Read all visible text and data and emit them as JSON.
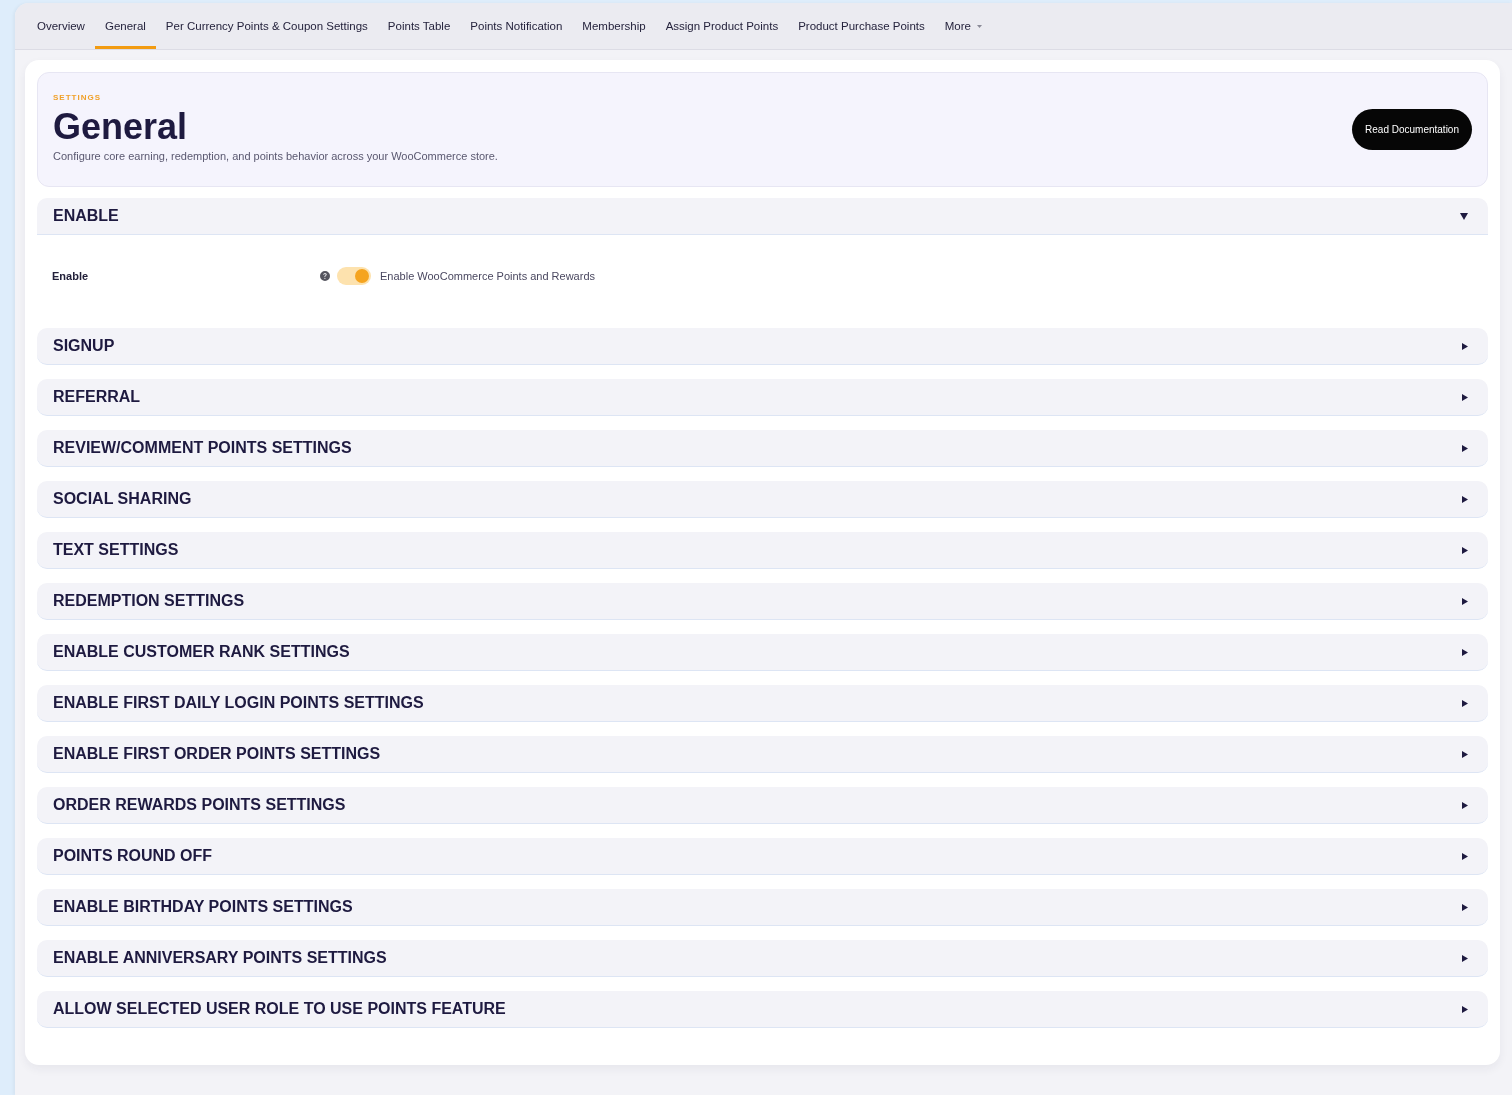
{
  "nav": {
    "tabs": [
      {
        "label": "Overview",
        "selected": false
      },
      {
        "label": "General",
        "selected": true
      },
      {
        "label": "Per Currency Points & Coupon Settings",
        "selected": false
      },
      {
        "label": "Points Table",
        "selected": false
      },
      {
        "label": "Points Notification",
        "selected": false
      },
      {
        "label": "Membership",
        "selected": false
      },
      {
        "label": "Assign Product Points",
        "selected": false
      },
      {
        "label": "Product Purchase Points",
        "selected": false
      }
    ],
    "more": {
      "label": "More"
    }
  },
  "header": {
    "eyebrow": "SETTINGS",
    "title": "General",
    "description": "Configure core earning, redemption, and points behavior across your WooCommerce store.",
    "button": "Read Documentation"
  },
  "sections": [
    {
      "title": "ENABLE",
      "expanded": true,
      "fields": [
        {
          "kind": "toggle",
          "label": "Enable",
          "on": true,
          "text": "Enable WooCommerce Points and Rewards"
        }
      ]
    },
    {
      "title": "SIGNUP",
      "expanded": false
    },
    {
      "title": "REFERRAL",
      "expanded": false
    },
    {
      "title": "REVIEW/COMMENT POINTS SETTINGS",
      "expanded": false
    },
    {
      "title": "SOCIAL SHARING",
      "expanded": false
    },
    {
      "title": "TEXT SETTINGS",
      "expanded": false
    },
    {
      "title": "REDEMPTION SETTINGS",
      "expanded": false
    },
    {
      "title": "ENABLE CUSTOMER RANK SETTINGS",
      "expanded": false
    },
    {
      "title": "ENABLE FIRST DAILY LOGIN POINTS SETTINGS",
      "expanded": false
    },
    {
      "title": "ENABLE FIRST ORDER POINTS SETTINGS",
      "expanded": false
    },
    {
      "title": "ORDER REWARDS POINTS SETTINGS",
      "expanded": false
    },
    {
      "title": "POINTS ROUND OFF",
      "expanded": false
    },
    {
      "title": "ENABLE BIRTHDAY POINTS SETTINGS",
      "expanded": false
    },
    {
      "title": "ENABLE ANNIVERSARY POINTS SETTINGS",
      "expanded": false
    },
    {
      "title": "ALLOW SELECTED USER ROLE TO USE POINTS FEATURE",
      "expanded": false
    }
  ]
}
